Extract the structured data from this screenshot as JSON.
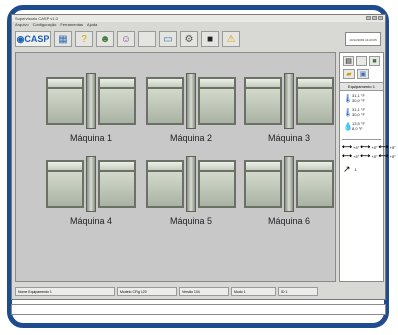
{
  "window": {
    "title": "Supervisorio CASP v1.0",
    "menu": [
      "Arquivo",
      "Configuração",
      "Ferramentas",
      "Ajuda"
    ]
  },
  "toolbar": {
    "logo_label": "CASP",
    "buttons": [
      "home-icon",
      "help-icon",
      "users-icon",
      "people-icon",
      "blank-icon",
      "monitor-icon",
      "settings-icon",
      "display-icon",
      "warning-icon"
    ]
  },
  "datetime": "10/12/2009 14:23:05",
  "machines": [
    {
      "label": "Máquina 1"
    },
    {
      "label": "Máquina 2"
    },
    {
      "label": "Máquina 3"
    },
    {
      "label": "Máquina 4"
    },
    {
      "label": "Máquina 5"
    },
    {
      "label": "Máquina 6"
    }
  ],
  "side_panel": {
    "title": "Equipamento 1",
    "sensors": [
      {
        "v1": "31,1 °F",
        "v2": "30,0 °F"
      },
      {
        "v1": "31,1 °F",
        "v2": "30,0 °F"
      },
      {
        "v1": "13,5 °F",
        "v2": "8,0 °F"
      }
    ],
    "grid": [
      {
        "g": "⟷",
        "t": "+5°"
      },
      {
        "g": "⟷",
        "t": "+5°"
      },
      {
        "g": "⟷",
        "t": "+5°"
      },
      {
        "g": "⟷",
        "t": "+5°"
      },
      {
        "g": "⟷",
        "t": "+5°"
      },
      {
        "g": "⟷",
        "t": "+5°"
      }
    ],
    "arrow_value": "1"
  },
  "statusbar": [
    "Nome Equipamento 1",
    "Modelo CFig 120",
    "Versão 104",
    "Modo 1",
    "ID 1"
  ],
  "colors": {
    "frame": "#1f4c8f",
    "accent": "#1f5fb5"
  }
}
